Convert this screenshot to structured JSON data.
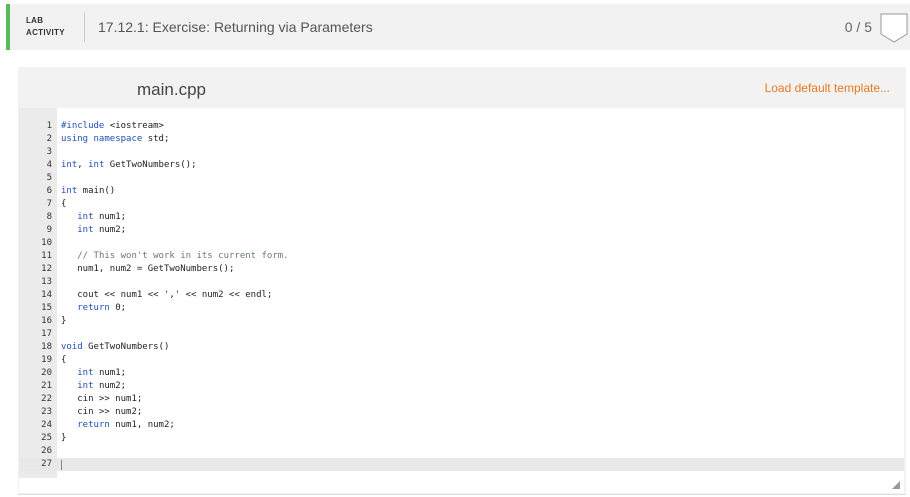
{
  "header": {
    "type_line1": "LAB",
    "type_line2": "ACTIVITY",
    "title": "17.12.1: Exercise: Returning via Parameters",
    "score": "0 / 5"
  },
  "editor": {
    "file_name": "main.cpp",
    "load_template": "Load default template...",
    "lines": [
      "#include <iostream>",
      "using namespace std;",
      "",
      "int, int GetTwoNumbers();",
      "",
      "int main()",
      "{",
      "   int num1;",
      "   int num2;",
      "",
      "   // This won't work in its current form.",
      "   num1, num2 = GetTwoNumbers();",
      "",
      "   cout << num1 << ',' << num2 << endl;",
      "   return 0;",
      "}",
      "",
      "void GetTwoNumbers()",
      "{",
      "   int num1;",
      "   int num2;",
      "   cin >> num1;",
      "   cin >> num2;",
      "   return num1, num2;",
      "}",
      "",
      ""
    ],
    "active_line": 27
  },
  "colors": {
    "accent_green": "#5cb85c",
    "link_orange": "#e77a1f",
    "keyword": "#1f4fb8",
    "comment": "#6a7a7a"
  },
  "icons": {
    "score_badge": "score-badge-icon",
    "resize": "resize-handle-icon"
  }
}
